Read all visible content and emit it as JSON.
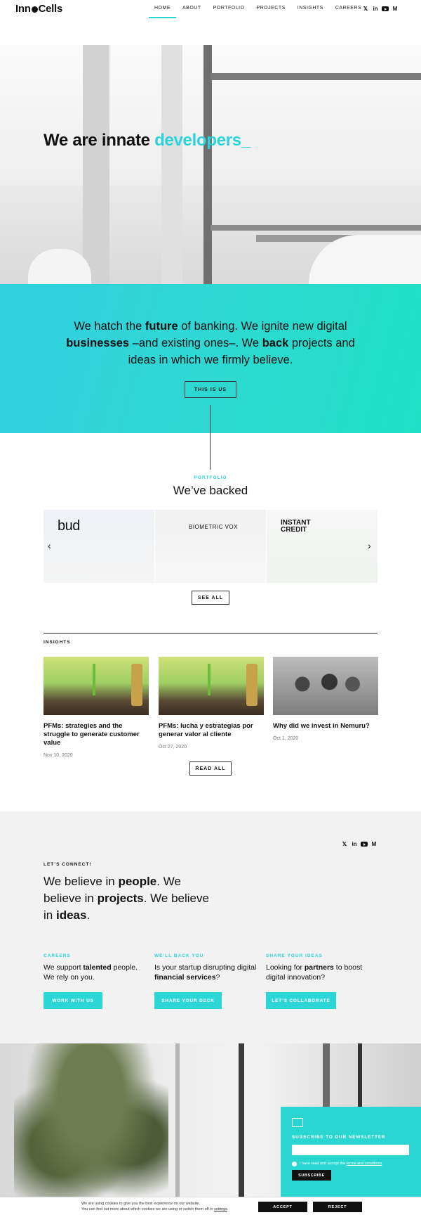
{
  "header": {
    "logo": "InnoCells",
    "nav": [
      "HOME",
      "ABOUT",
      "PORTFOLIO",
      "PROJECTS",
      "INSIGHTS",
      "CAREERS"
    ],
    "active_nav": "HOME",
    "socials": [
      "twitter-icon",
      "linkedin-icon",
      "youtube-icon",
      "medium-icon"
    ]
  },
  "hero": {
    "title_plain": "We are innate ",
    "title_accent": "developers_"
  },
  "band": {
    "t1": "We hatch the ",
    "b1": "future",
    "t2": " of banking. We ignite new digital ",
    "b2": "businesses",
    "t3": " –and existing ones–. We ",
    "b3": "back",
    "t4": " projects and ideas in which we firmly believe.",
    "button": "THIS IS US"
  },
  "portfolio": {
    "eyebrow": "PORTFOLIO",
    "title": "We’ve backed",
    "slides": [
      "bud",
      "BIOMETRIC VOX",
      "INSTANT CREDIT"
    ],
    "see_all": "SEE ALL"
  },
  "insights": {
    "eyebrow": "INSIGHTS",
    "cards": [
      {
        "title": "PFMs: strategies and the struggle to generate customer value",
        "date": "Nov 10, 2020"
      },
      {
        "title": "PFMs: lucha y estrategias por generar valor al cliente",
        "date": "Oct 27, 2020"
      },
      {
        "title": "Why did we invest in Nemuru?",
        "date": "Oct 1, 2020"
      }
    ],
    "read_all": "READ ALL"
  },
  "connect": {
    "eyebrow": "LET’S CONNECT!",
    "t1": "We believe in ",
    "b1": "people",
    "t2": ". We believe in ",
    "b2": "projects",
    "t3": ". We believe in ",
    "b3": "ideas",
    "t4": ".",
    "columns": [
      {
        "eyebrow": "CAREERS",
        "pre": "We support ",
        "bold": "talented",
        "post": " people. We rely on you.",
        "button": "WORK WITH US"
      },
      {
        "eyebrow": "WE’LL BACK YOU",
        "pre": "Is your startup disrupting digital ",
        "bold": "financial services",
        "post": "?",
        "button": "SHARE YOUR DECK"
      },
      {
        "eyebrow": "SHARE YOUR IDEAS",
        "pre": "Looking for ",
        "bold": "partners",
        "post": " to boost digital innovation?",
        "button": "LET’S COLLABORATE"
      }
    ]
  },
  "newsletter": {
    "title": "SUBSCRIBE TO OUR NEWSLETTER",
    "input_value": "",
    "legal_pre": "I have read and accept the ",
    "legal_link": "terms and conditions",
    "button": "SUBSCRIBE"
  },
  "cookie": {
    "line1": "We are using cookies to give you the best experience on our website.",
    "line2_pre": "You can find out more about which cookies we are using or switch them off in ",
    "line2_link": "settings",
    "line2_post": ".",
    "accept": "ACCEPT",
    "reject": "REJECT"
  },
  "colors": {
    "accent": "#2dd3dc",
    "band_start": "#33cfe0",
    "band_end": "#1fe0c4"
  }
}
